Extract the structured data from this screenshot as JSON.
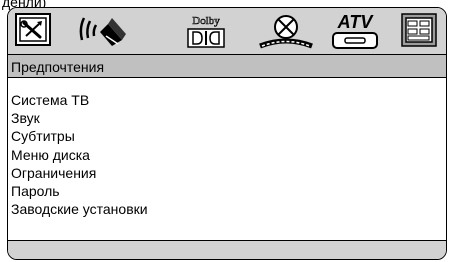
{
  "header_fragment": "денли)",
  "iconbar": {
    "icons": [
      {
        "name": "general-setup-icon"
      },
      {
        "name": "audio-setup-icon"
      },
      {
        "name": "dolby-setup-icon",
        "label": "Dolby"
      },
      {
        "name": "video-setup-icon"
      },
      {
        "name": "atv-tuner-icon",
        "label": "ATV"
      },
      {
        "name": "preferences-icon"
      }
    ]
  },
  "title": "Предпочтения",
  "menu": {
    "items": [
      "Система ТВ",
      "Звук",
      "Субтитры",
      "Меню диска",
      "Ограничения",
      "Пароль",
      "Заводские установки"
    ]
  }
}
